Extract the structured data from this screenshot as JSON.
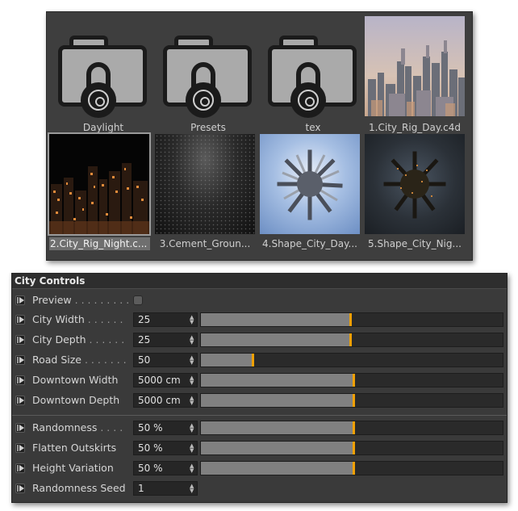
{
  "browser": {
    "items": [
      {
        "label": "Daylight",
        "type": "folder"
      },
      {
        "label": "Presets",
        "type": "folder"
      },
      {
        "label": "tex",
        "type": "folder"
      },
      {
        "label": "1.City_Rig_Day.c4d",
        "type": "image"
      },
      {
        "label": "2.City_Rig_Night.c...",
        "type": "image",
        "selected": true
      },
      {
        "label": "3.Cement_Groun...",
        "type": "image"
      },
      {
        "label": "4.Shape_City_Day...",
        "type": "image"
      },
      {
        "label": "5.Shape_City_Nig...",
        "type": "image"
      }
    ],
    "icons": {
      "folder": "locked-folder-icon"
    }
  },
  "controls": {
    "title": "City Controls",
    "accent": "#f0a000",
    "rows": [
      {
        "label": "Preview",
        "dots": " . . . . . . . . .",
        "kind": "checkbox",
        "checked": false
      },
      {
        "label": "City Width",
        "dots": " . . . . . .",
        "kind": "slider",
        "value": "25",
        "fill": 0.495
      },
      {
        "label": "City Depth",
        "dots": " . . . . . .",
        "kind": "slider",
        "value": "25",
        "fill": 0.495
      },
      {
        "label": "Road Size",
        "dots": " . . . . . . .",
        "kind": "slider",
        "value": "50",
        "fill": 0.17
      },
      {
        "label": "Downtown Width",
        "dots": "",
        "kind": "slider",
        "value": "5000 cm",
        "fill": 0.505
      },
      {
        "label": "Downtown Depth",
        "dots": "",
        "kind": "slider",
        "value": "5000 cm",
        "fill": 0.505
      },
      {
        "label": "Randomness",
        "dots": " . . . .",
        "kind": "slider",
        "value": "50 %",
        "fill": 0.505
      },
      {
        "label": "Flatten Outskirts",
        "dots": "",
        "kind": "slider",
        "value": "50 %",
        "fill": 0.505
      },
      {
        "label": "Height Variation",
        "dots": "",
        "kind": "slider",
        "value": "50 %",
        "fill": 0.505
      },
      {
        "label": "Randomness Seed",
        "dots": "",
        "kind": "field",
        "value": "1"
      }
    ]
  }
}
